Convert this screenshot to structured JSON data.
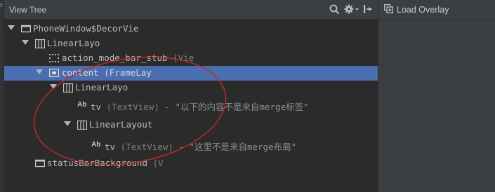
{
  "left_strip_letter": "e",
  "panel": {
    "title": "View Tree"
  },
  "right_panel": {
    "load_overlay_label": "Load Overlay"
  },
  "tree": {
    "rows": [
      {
        "name": "PhoneWindow$DecorVie"
      },
      {
        "name": "LinearLayo"
      },
      {
        "name": "action_mode_bar_stub",
        "sub": "(Vie"
      },
      {
        "name": "content",
        "sub": "(FrameLay"
      },
      {
        "name": "LinearLayo"
      },
      {
        "icon_text": "Ab",
        "name": "tv",
        "sub": "(TextView)",
        "dash": "-",
        "value": "\"以下的内容不是来自merge标签\""
      },
      {
        "name": "LinearLayout"
      },
      {
        "icon_text": "Ab",
        "name": "tv",
        "sub": "(TextView)",
        "dash": "-",
        "value": "\"这里不是来自merge布局\""
      },
      {
        "name": "statusBarBackground",
        "sub": "(V"
      }
    ]
  },
  "colors": {
    "selection": "#4b6eaf",
    "annotation_ellipse": "#c62828"
  }
}
